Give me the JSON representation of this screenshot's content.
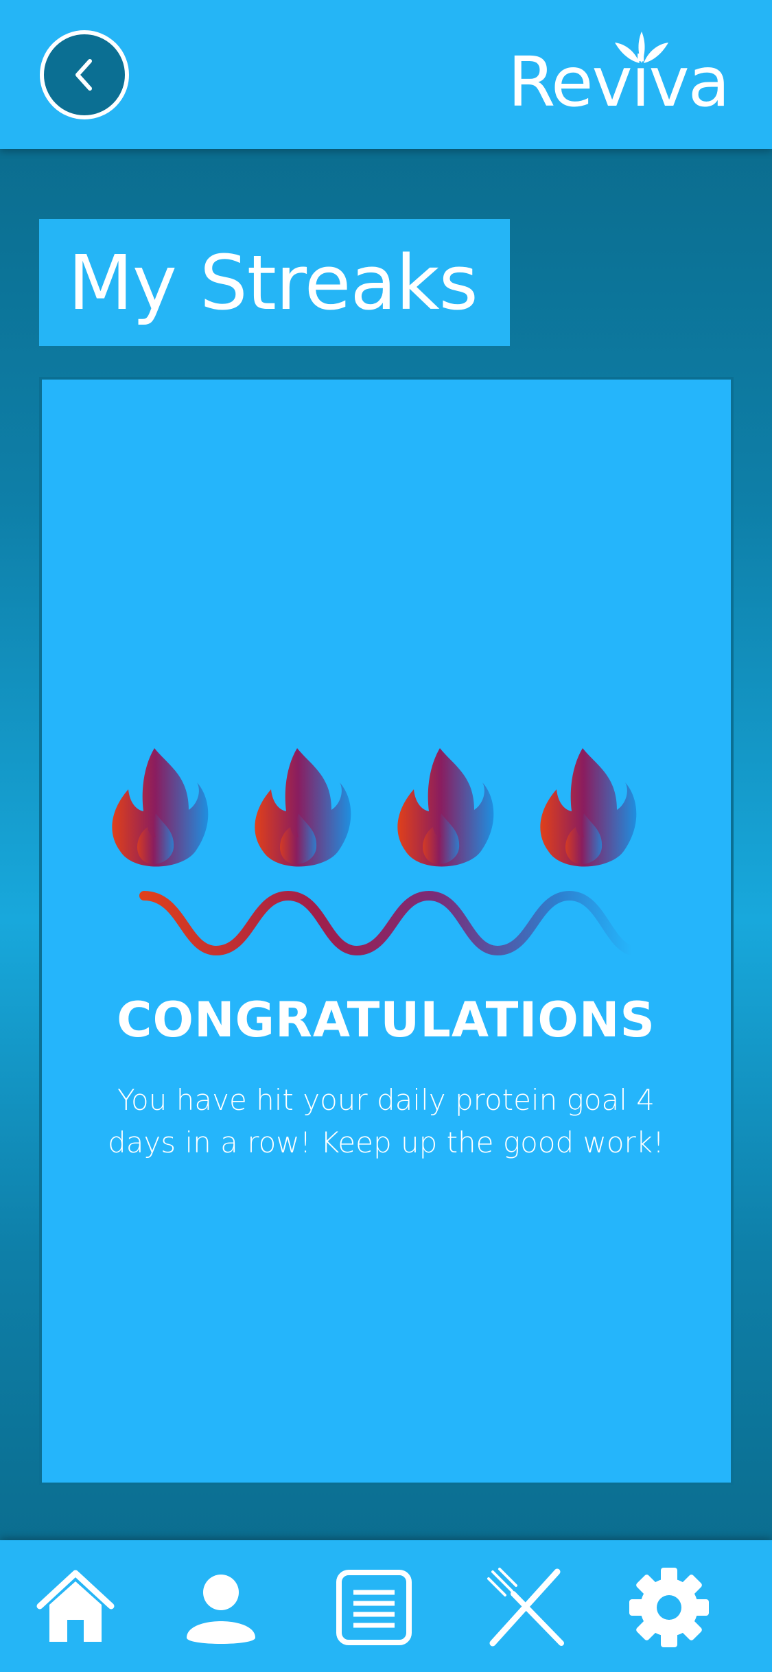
{
  "header": {
    "back_icon": "chevron-left-icon",
    "logo_text": "Reviva"
  },
  "main": {
    "title": "My Streaks",
    "streak_count": 4,
    "congrats_heading": "CONGRATULATIONS",
    "message": "You have hit your daily protein goal 4 days in a row! Keep up the good work!"
  },
  "tabbar": {
    "items": [
      {
        "icon": "home-icon"
      },
      {
        "icon": "profile-icon"
      },
      {
        "icon": "list-icon"
      },
      {
        "icon": "utensils-icon"
      },
      {
        "icon": "gear-icon"
      }
    ]
  },
  "colors": {
    "header": "#25b5f6",
    "background": "#0b6f93",
    "card": "#25b5fb",
    "flame_red": "#e0401a",
    "flame_purple": "#8a1d5f",
    "flame_blue": "#1e8fe0"
  }
}
